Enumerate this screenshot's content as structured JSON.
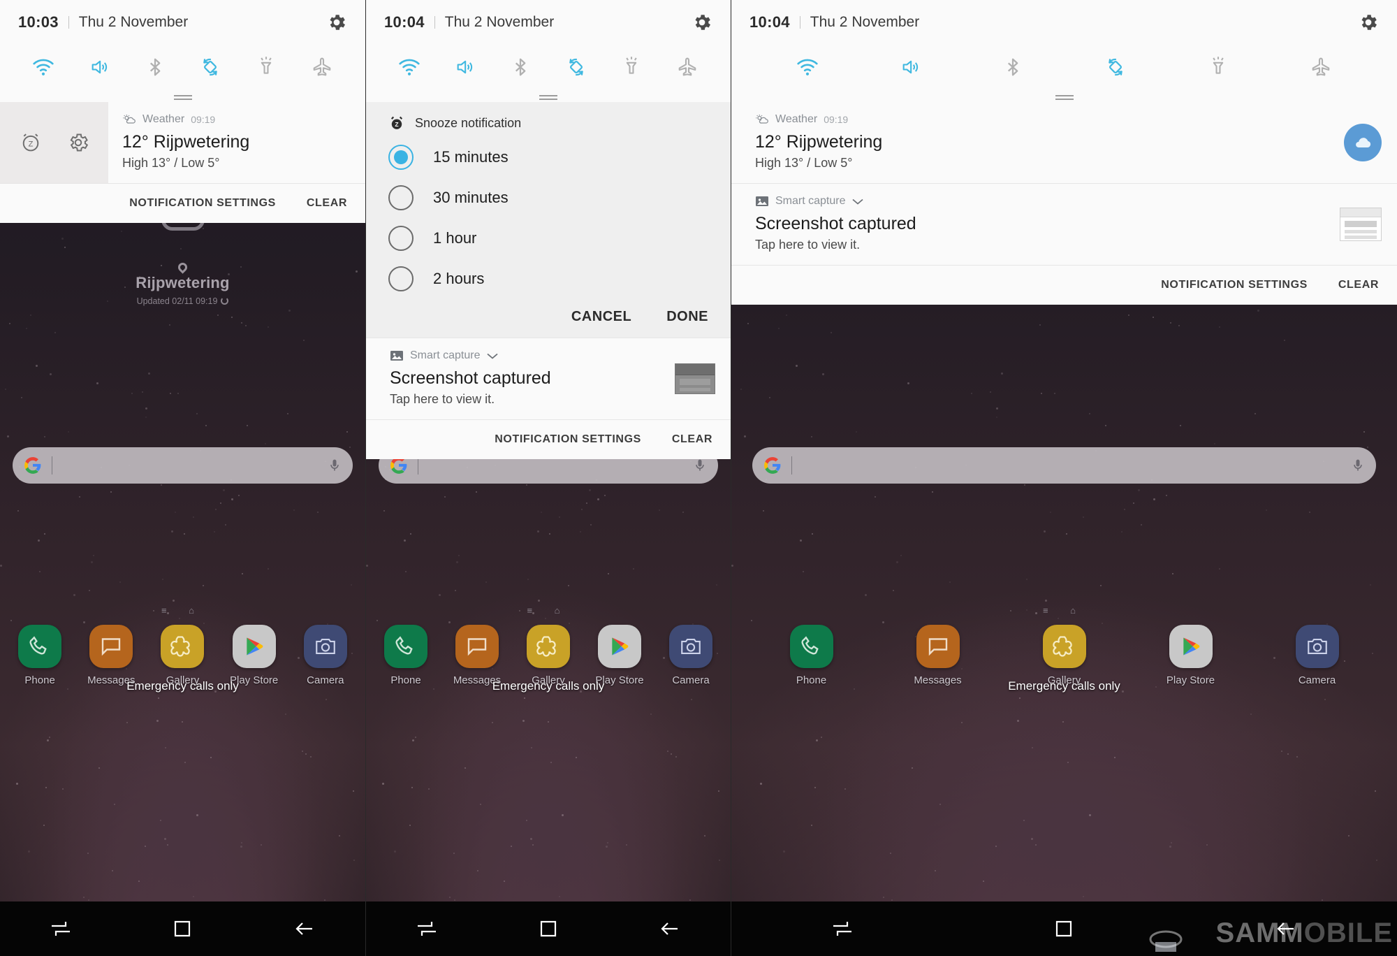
{
  "panels": [
    {
      "id": "panel-1",
      "status": {
        "time": "10:03",
        "date": "Thu 2 November",
        "settings_icon": "gear-icon"
      },
      "toggles": [
        {
          "name": "wifi-toggle",
          "label": "Wi-Fi",
          "on": true
        },
        {
          "name": "sound-toggle",
          "label": "Sound",
          "on": true
        },
        {
          "name": "bluetooth-toggle",
          "label": "Bluetooth",
          "on": false
        },
        {
          "name": "auto-rotate-toggle",
          "label": "Auto rotate",
          "on": true
        },
        {
          "name": "flashlight-toggle",
          "label": "Flashlight",
          "on": false
        },
        {
          "name": "airplane-toggle",
          "label": "Flight mode",
          "on": false
        }
      ],
      "notification": {
        "snooze_icon": "snooze-alarm-icon",
        "settings_icon": "gear-icon",
        "app": "Weather",
        "time": "09:19",
        "title": "12° Rijpwetering",
        "subtitle": "High 13° / Low 5°"
      },
      "actions": {
        "settings": "NOTIFICATION SETTINGS",
        "clear": "CLEAR"
      }
    },
    {
      "id": "panel-2",
      "status": {
        "time": "10:04",
        "date": "Thu 2 November",
        "settings_icon": "gear-icon"
      },
      "toggles": [
        {
          "name": "wifi-toggle",
          "label": "Wi-Fi",
          "on": true
        },
        {
          "name": "sound-toggle",
          "label": "Sound",
          "on": true
        },
        {
          "name": "bluetooth-toggle",
          "label": "Bluetooth",
          "on": false
        },
        {
          "name": "auto-rotate-toggle",
          "label": "Auto rotate",
          "on": true
        },
        {
          "name": "flashlight-toggle",
          "label": "Flashlight",
          "on": false
        },
        {
          "name": "airplane-toggle",
          "label": "Flight mode",
          "on": false
        }
      ],
      "snooze_dialog": {
        "icon": "snooze-alarm-icon",
        "title": "Snooze notification",
        "options": [
          {
            "label": "15 minutes",
            "selected": true
          },
          {
            "label": "30 minutes",
            "selected": false
          },
          {
            "label": "1 hour",
            "selected": false
          },
          {
            "label": "2 hours",
            "selected": false
          }
        ],
        "cancel": "CANCEL",
        "done": "DONE"
      },
      "notification": {
        "app": "Smart capture",
        "app_icon": "image-icon",
        "expand_icon": "chevron-down-icon",
        "title": "Screenshot captured",
        "subtitle": "Tap here to view it."
      },
      "actions": {
        "settings": "NOTIFICATION SETTINGS",
        "clear": "CLEAR"
      }
    },
    {
      "id": "panel-3",
      "status": {
        "time": "10:04",
        "date": "Thu 2 November",
        "settings_icon": "gear-icon"
      },
      "toggles": [
        {
          "name": "wifi-toggle",
          "label": "Wi-Fi",
          "on": true
        },
        {
          "name": "sound-toggle",
          "label": "Sound",
          "on": true
        },
        {
          "name": "bluetooth-toggle",
          "label": "Bluetooth",
          "on": false
        },
        {
          "name": "auto-rotate-toggle",
          "label": "Auto rotate",
          "on": true
        },
        {
          "name": "flashlight-toggle",
          "label": "Flashlight",
          "on": false
        },
        {
          "name": "airplane-toggle",
          "label": "Flight mode",
          "on": false
        }
      ],
      "notifications": [
        {
          "app": "Weather",
          "app_icon": "weather-sun-cloud-icon",
          "time": "09:19",
          "title": "12° Rijpwetering",
          "subtitle": "High 13° / Low 5°",
          "thumb": "cloud-badge-icon"
        },
        {
          "app": "Smart capture",
          "app_icon": "image-icon",
          "expand_icon": "chevron-down-icon",
          "title": "Screenshot captured",
          "subtitle": "Tap here to view it.",
          "thumb": "screenshot-thumbnail"
        }
      ],
      "actions": {
        "settings": "NOTIFICATION SETTINGS",
        "clear": "CLEAR"
      }
    }
  ],
  "home": {
    "weather_widget": {
      "location": "Rijpwetering",
      "updated": "Updated 02/11 09:19",
      "location_icon": "map-pin-icon",
      "cloud_icon": "cloud-icon",
      "refresh_icon": "refresh-icon"
    },
    "search": {
      "logo": "google-logo-icon",
      "mic": "microphone-icon",
      "value": "",
      "placeholder": ""
    },
    "dock": [
      {
        "label": "Phone",
        "icon": "phone-icon",
        "color": "#0e7a4a"
      },
      {
        "label": "Messages",
        "icon": "message-bubble-icon",
        "color": "#b5651d"
      },
      {
        "label": "Gallery",
        "icon": "flower-icon",
        "color": "#c9a227"
      },
      {
        "label": "Play Store",
        "icon": "play-store-icon",
        "color": "#c8c8c8"
      },
      {
        "label": "Camera",
        "icon": "camera-icon",
        "color": "#3f4a74"
      }
    ],
    "page_indicator": "≡   ⌂",
    "carrier_status": "Emergency calls only"
  },
  "navbar": [
    {
      "name": "recents-button",
      "icon": "recents-icon"
    },
    {
      "name": "home-button",
      "icon": "home-square-icon"
    },
    {
      "name": "back-button",
      "icon": "back-arrow-icon"
    }
  ],
  "watermark": {
    "bold": "SAMM",
    "light": "OBILE"
  }
}
